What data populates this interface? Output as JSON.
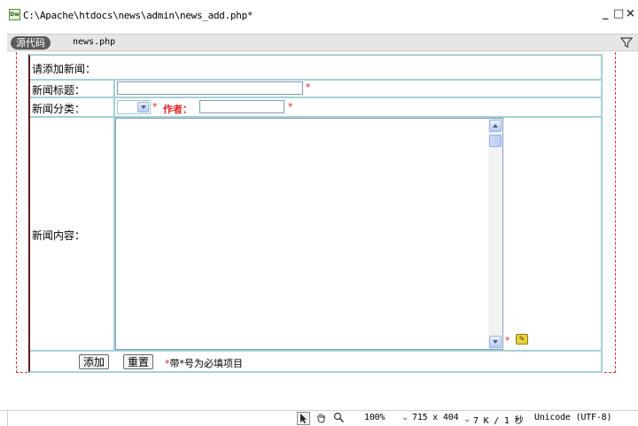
{
  "window": {
    "title": "C:\\Apache\\htdocs\\news\\admin\\news_add.php*",
    "app_icon": "Dw",
    "minimize": "_",
    "maximize": "□",
    "close": "×"
  },
  "doc_toolbar": {
    "source_label": "源代码",
    "filename": "news.php",
    "filter_icon": "filter-icon"
  },
  "form": {
    "heading": "请添加新闻：",
    "title_label": "新闻标题：",
    "title_value": "",
    "title_required": "*",
    "category_label": "新闻分类：",
    "category_value": "",
    "category_required": "*",
    "author_label": "作者：",
    "author_value": "",
    "author_required": "*",
    "content_label": "新闻内容：",
    "content_value": "",
    "content_required": "*",
    "submit_label": "添加",
    "reset_label": "重置",
    "note_star": "*",
    "note_text": "带*号为必填项目"
  },
  "statusbar": {
    "zoom": "100%",
    "dimensions": "715 x 404",
    "size_time": "7 K / 1 秒",
    "encoding": "Unicode (UTF-8)",
    "tools": [
      "pointer-icon",
      "hand-icon",
      "zoom-icon"
    ]
  },
  "colors": {
    "required": "#e02020",
    "table_border": "#a6d0d6",
    "dashed_border": "#e03030"
  }
}
